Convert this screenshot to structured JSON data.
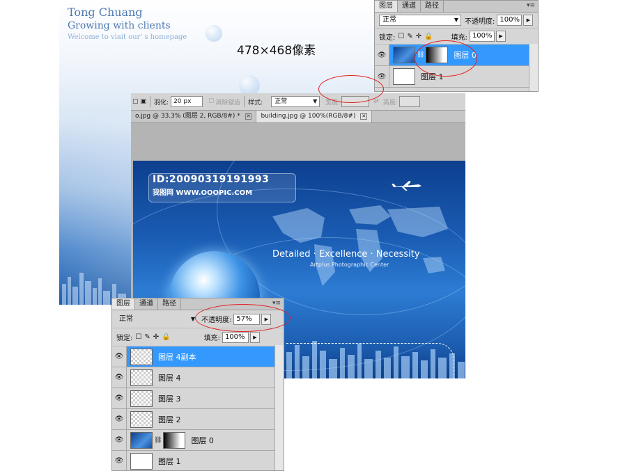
{
  "template": {
    "company_name": "Tong Chuang",
    "slogan": "Growing with clients",
    "welcome": "Welcome to viait our' s homepage"
  },
  "dimension_label": "478×468像素",
  "layers_panel_top": {
    "tabs": [
      "图层",
      "通道",
      "路径"
    ],
    "menu_icon": "▾≡",
    "blend_mode": "正常",
    "opacity_label": "不透明度:",
    "opacity_value": "100%",
    "lock_label": "锁定:",
    "fill_label": "填充:",
    "fill_value": "100%",
    "layers": [
      {
        "name": "图层 0",
        "thumb": "blue",
        "mask": true,
        "selected": true
      },
      {
        "name": "图层 1",
        "thumb": "white",
        "mask": false,
        "selected": false
      }
    ]
  },
  "options_bar": {
    "feather_label": "羽化:",
    "feather_value": "20 px",
    "antialias_label": "消除锯齿",
    "style_label": "样式:",
    "style_value": "正常",
    "width_label": "宽度:",
    "height_label": "高度:"
  },
  "document_tabs": [
    {
      "label": "o.jpg @ 33.3% (图层 2, RGB/8#) *",
      "active": false
    },
    {
      "label": "building.jpg @ 100%(RGB/8#)",
      "active": true
    }
  ],
  "canvas": {
    "id_text": "ID:20090319191993",
    "site_text": "我图网  WWW.OOOPIC.COM",
    "headline": "Detailed · Excellence · Necessity",
    "subline": "Artplus Photographic Center"
  },
  "layers_panel_bottom": {
    "tabs": [
      "图层",
      "通道",
      "路径"
    ],
    "menu_icon": "▾≡",
    "blend_mode": "正常",
    "opacity_label": "不透明度:",
    "opacity_value": "57%",
    "lock_label": "锁定:",
    "fill_label": "填充:",
    "fill_value": "100%",
    "layers": [
      {
        "name": "图层 4副本",
        "thumb": "checker",
        "selected": true
      },
      {
        "name": "图层 4",
        "thumb": "checker",
        "selected": false
      },
      {
        "name": "图层 3",
        "thumb": "checker",
        "selected": false
      },
      {
        "name": "图层 2",
        "thumb": "checker",
        "selected": false
      },
      {
        "name": "图层 0",
        "thumb": "blue",
        "mask": true,
        "selected": false
      },
      {
        "name": "图层 1",
        "thumb": "white",
        "selected": false
      }
    ]
  },
  "colors": {
    "selection_blue": "#3399ff",
    "annotation_red": "#e02020",
    "panel_gray": "#d6d6d6"
  }
}
